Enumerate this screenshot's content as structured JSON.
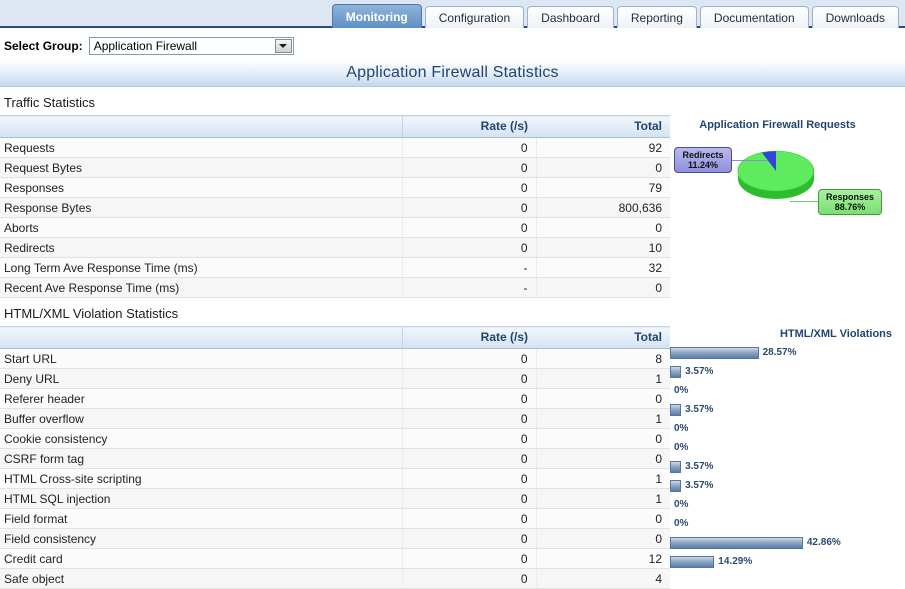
{
  "tabs": [
    {
      "label": "Monitoring",
      "active": true
    },
    {
      "label": "Configuration",
      "active": false
    },
    {
      "label": "Dashboard",
      "active": false
    },
    {
      "label": "Reporting",
      "active": false
    },
    {
      "label": "Documentation",
      "active": false
    },
    {
      "label": "Downloads",
      "active": false
    }
  ],
  "group_selector": {
    "label": "Select Group:",
    "value": "Application Firewall"
  },
  "page_title": "Application Firewall Statistics",
  "traffic": {
    "heading": "Traffic Statistics",
    "columns": [
      "",
      "Rate (/s)",
      "Total"
    ],
    "rows": [
      {
        "name": "Requests",
        "rate": "0",
        "total": "92"
      },
      {
        "name": "Request Bytes",
        "rate": "0",
        "total": "0"
      },
      {
        "name": "Responses",
        "rate": "0",
        "total": "79"
      },
      {
        "name": "Response Bytes",
        "rate": "0",
        "total": "800,636"
      },
      {
        "name": "Aborts",
        "rate": "0",
        "total": "0"
      },
      {
        "name": "Redirects",
        "rate": "0",
        "total": "10"
      },
      {
        "name": "Long Term Ave Response Time (ms)",
        "rate": "-",
        "total": "32"
      },
      {
        "name": "Recent Ave Response Time (ms)",
        "rate": "-",
        "total": "0"
      }
    ]
  },
  "violations": {
    "heading": "HTML/XML Violation Statistics",
    "columns": [
      "",
      "Rate (/s)",
      "Total"
    ],
    "rows": [
      {
        "name": "Start URL",
        "rate": "0",
        "total": "8"
      },
      {
        "name": "Deny URL",
        "rate": "0",
        "total": "1"
      },
      {
        "name": "Referer header",
        "rate": "0",
        "total": "0"
      },
      {
        "name": "Buffer overflow",
        "rate": "0",
        "total": "1"
      },
      {
        "name": "Cookie consistency",
        "rate": "0",
        "total": "0"
      },
      {
        "name": "CSRF form tag",
        "rate": "0",
        "total": "0"
      },
      {
        "name": "HTML Cross-site scripting",
        "rate": "0",
        "total": "1"
      },
      {
        "name": "HTML SQL injection",
        "rate": "0",
        "total": "1"
      },
      {
        "name": "Field format",
        "rate": "0",
        "total": "0"
      },
      {
        "name": "Field consistency",
        "rate": "0",
        "total": "0"
      },
      {
        "name": "Credit card",
        "rate": "0",
        "total": "12"
      },
      {
        "name": "Safe object",
        "rate": "0",
        "total": "4"
      }
    ]
  },
  "chart_data": [
    {
      "type": "pie",
      "title": "Application Firewall Requests",
      "labels": [
        "Redirects",
        "Responses"
      ],
      "values": [
        11.24,
        88.76
      ],
      "value_labels": [
        "11.24%",
        "88.76%"
      ],
      "colors": [
        "#3344dd",
        "#5eec5e"
      ],
      "legend": "callouts",
      "three_d": true
    },
    {
      "type": "bar",
      "title": "HTML/XML Violations",
      "orientation": "horizontal",
      "categories": [
        "Start URL",
        "Deny URL",
        "Referer header",
        "Buffer overflow",
        "Cookie consistency",
        "CSRF form tag",
        "HTML Cross-site scripting",
        "HTML SQL injection",
        "Field format",
        "Field consistency",
        "Credit card",
        "Safe object"
      ],
      "values": [
        28.57,
        3.57,
        0,
        3.57,
        0,
        0,
        3.57,
        3.57,
        0,
        0,
        42.86,
        14.29
      ],
      "value_labels": [
        "28.57%",
        "3.57%",
        "0%",
        "3.57%",
        "0%",
        "0%",
        "3.57%",
        "3.57%",
        "0%",
        "0%",
        "42.86%",
        "14.29%"
      ],
      "xlim": [
        0,
        100
      ],
      "bar_color": "#5c7ea6",
      "grid": false
    }
  ]
}
